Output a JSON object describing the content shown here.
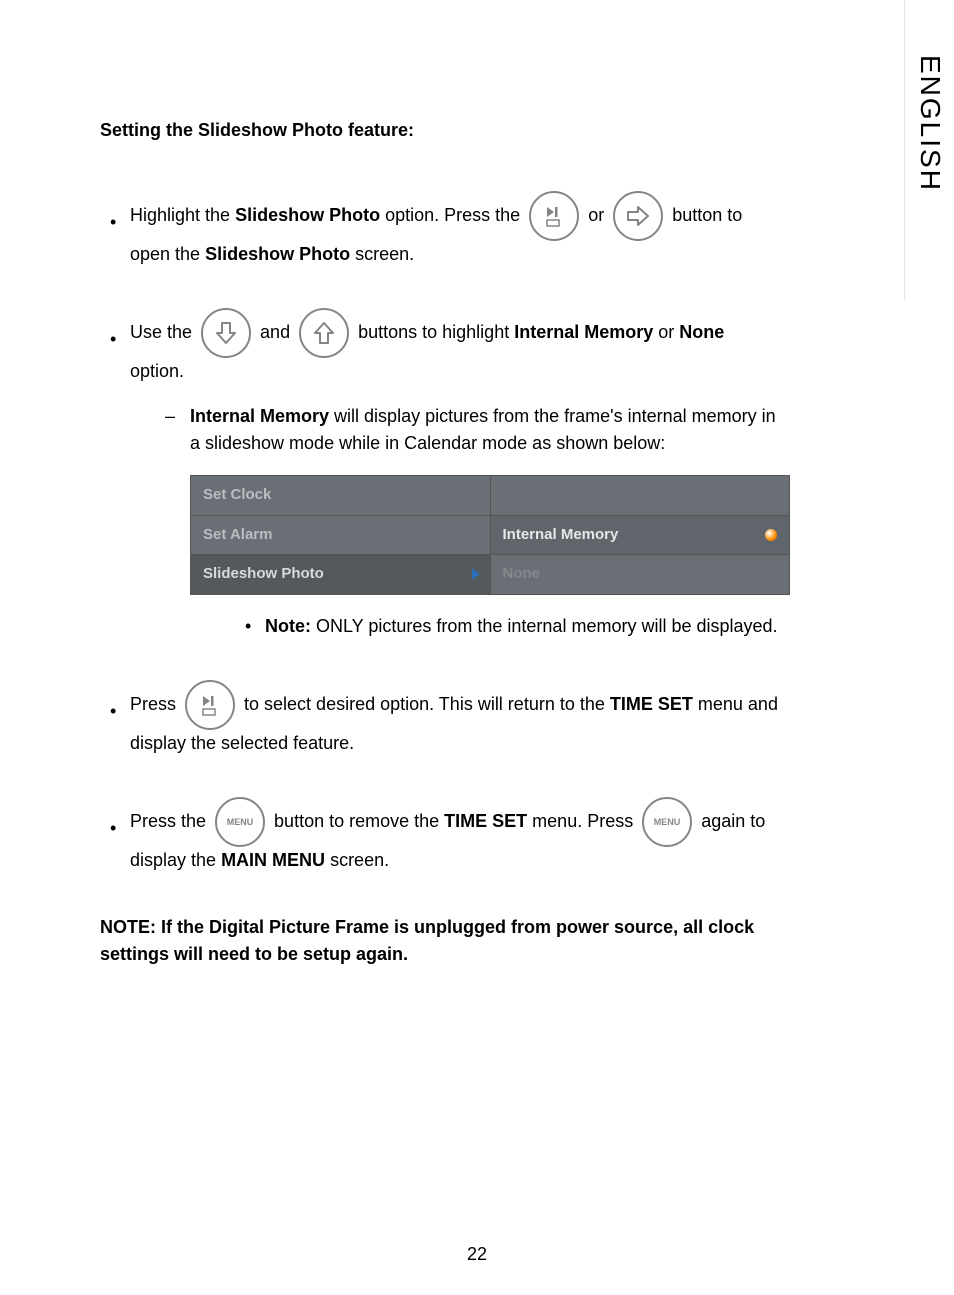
{
  "sideTab": "ENGLISH",
  "heading": "Setting the Slideshow Photo feature:",
  "b1": {
    "t1": "Highlight the ",
    "bold1": "Slideshow Photo",
    "t2": " option. Press the ",
    "t3": " or ",
    "t4": " button to open the ",
    "bold2": "Slideshow Photo",
    "t5": " screen."
  },
  "b2": {
    "t1": "Use the ",
    "t2": " and ",
    "t3": " buttons to highlight ",
    "bold1": "Internal Memory",
    "t4": " or ",
    "bold2": "None",
    "t5": " option."
  },
  "sub1": {
    "bold1": "Internal Memory",
    "t1": " will display pictures from the frame's internal memory in a slideshow mode while in Calendar mode as shown below:"
  },
  "menu": {
    "r1l": "Set Clock",
    "r2l": "Set Alarm",
    "r2r": "Internal Memory",
    "r3l": "Slideshow Photo",
    "r3r": "None"
  },
  "sub2": {
    "bold1": "Note:",
    "t1": " ONLY pictures from the internal memory will be displayed."
  },
  "b3": {
    "t1": "Press ",
    "t2": " to select desired option. This will return to the ",
    "bold1": "TIME SET",
    "t3": " menu and display the selected feature."
  },
  "b4": {
    "t1": "Press the ",
    "t2": " button to remove the ",
    "bold1": "TIME SET",
    "t3": " menu. Press ",
    "t4": " again to display the ",
    "bold2": "MAIN MENU",
    "t5": " screen."
  },
  "noteFinal": "NOTE: If the Digital Picture Frame is unplugged from power source, all clock settings will need to be setup again.",
  "pageNum": "22",
  "menuBtnLabel": "MENU"
}
